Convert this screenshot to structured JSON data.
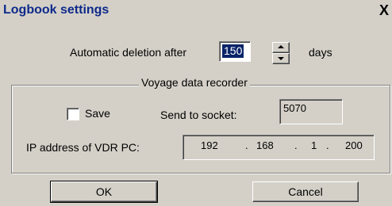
{
  "window": {
    "title": "Logbook settings",
    "close_glyph": "X"
  },
  "deletion": {
    "label": "Automatic deletion after",
    "value": "150",
    "unit": "days"
  },
  "vdr": {
    "group_label": "Voyage data recorder",
    "save_label": "Save",
    "save_checked": false,
    "socket_label": "Send to socket:",
    "socket_value": "5070",
    "ip_label": "IP address of VDR PC:",
    "ip_parts": [
      "192",
      "168",
      "1",
      "200"
    ],
    "ip_separator": "."
  },
  "buttons": {
    "ok_label": "OK",
    "cancel_label": "Cancel"
  },
  "colors": {
    "title_text": "#0d2a8a",
    "selection": "#0a246a",
    "background": "#d4d0c8"
  }
}
